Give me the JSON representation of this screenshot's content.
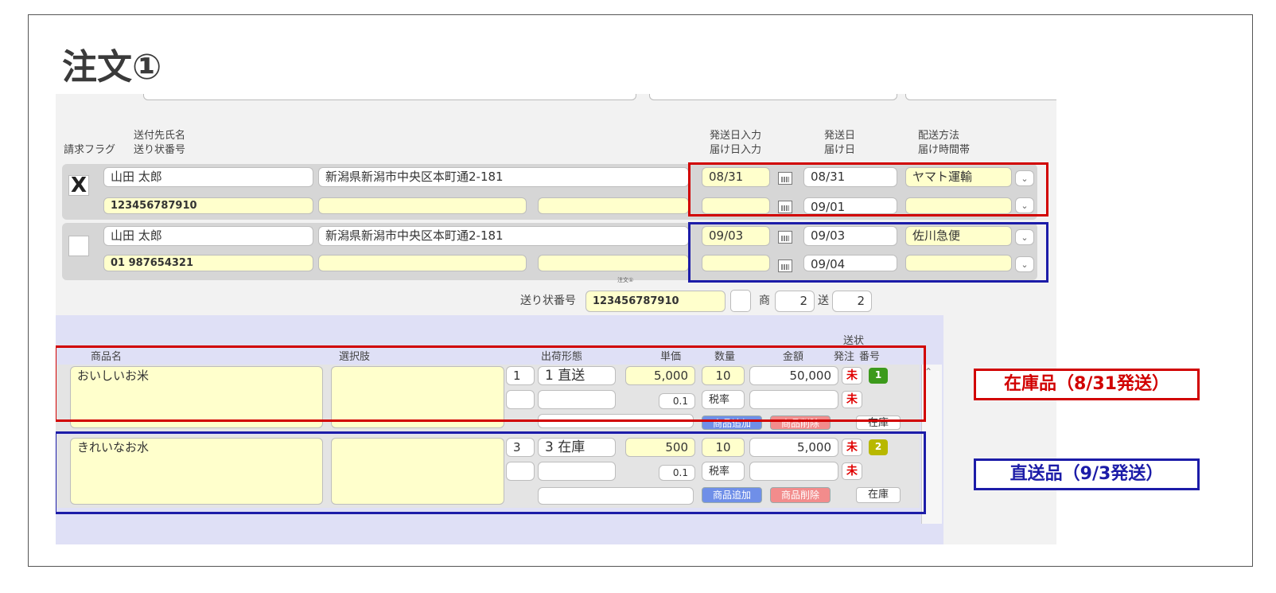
{
  "title": "注文①",
  "header": {
    "billing_flag": "請求フラグ",
    "recipient_name": "送付先氏名",
    "tracking_no": "送り状番号",
    "ship_date_input": "発送日入力",
    "delivery_date_input": "届け日入力",
    "ship_date": "発送日",
    "delivery_date": "届け日",
    "shipping_method": "配送方法",
    "delivery_time": "届け時間帯"
  },
  "shipments": [
    {
      "checked": "X",
      "name": "山田 太郎",
      "tracking": "123456787910",
      "address": "新潟県新潟市中央区本町通2-181",
      "ship_input": "08/31",
      "ship_date": "08/31",
      "delivery_date": "09/01",
      "carrier": "ヤマト運輸"
    },
    {
      "checked": "",
      "name": "山田 太郎",
      "tracking": "01 987654321",
      "address": "新潟県新潟市中央区本町通2-181",
      "ship_input": "09/03",
      "ship_date": "09/03",
      "delivery_date": "09/04",
      "carrier": "佐川急便"
    }
  ],
  "tiny_label": "注文①",
  "tracking_bar": {
    "label": "送り状番号",
    "value": "123456787910",
    "shou_label": "商",
    "shou_value": "2",
    "sou_label": "送",
    "sou_value": "2"
  },
  "items_header": {
    "product": "商品名",
    "option": "選択肢",
    "shipping_form": "出荷形態",
    "unit_price": "単価",
    "quantity": "数量",
    "amount": "金額",
    "invoice": "送状",
    "order": "発注",
    "number": "番号"
  },
  "items": [
    {
      "name": "おいしいお米",
      "form_no": "1",
      "form": "1 直送",
      "unit_price": "5,000",
      "qty": "10",
      "amount": "50,000",
      "tax": "0.1",
      "tax_label": "税率",
      "mark1": "未",
      "mark2": "未",
      "badge": "1",
      "badge_color": "#3c9a1c",
      "add": "商品追加",
      "del": "商品削除",
      "stock": "在庫"
    },
    {
      "name": "きれいなお水",
      "form_no": "3",
      "form": "3 在庫",
      "unit_price": "500",
      "qty": "10",
      "amount": "5,000",
      "tax": "0.1",
      "tax_label": "税率",
      "mark1": "未",
      "mark2": "未",
      "badge": "2",
      "badge_color": "#b8b800",
      "add": "商品追加",
      "del": "商品削除",
      "stock": "在庫"
    }
  ],
  "callouts": {
    "stock_item": "在庫品（8/31発送）",
    "direct_item": "直送品（9/3発送）"
  },
  "colors": {
    "red": "#d10000",
    "blue": "#1c1ca8",
    "field": "#ffffcc"
  }
}
